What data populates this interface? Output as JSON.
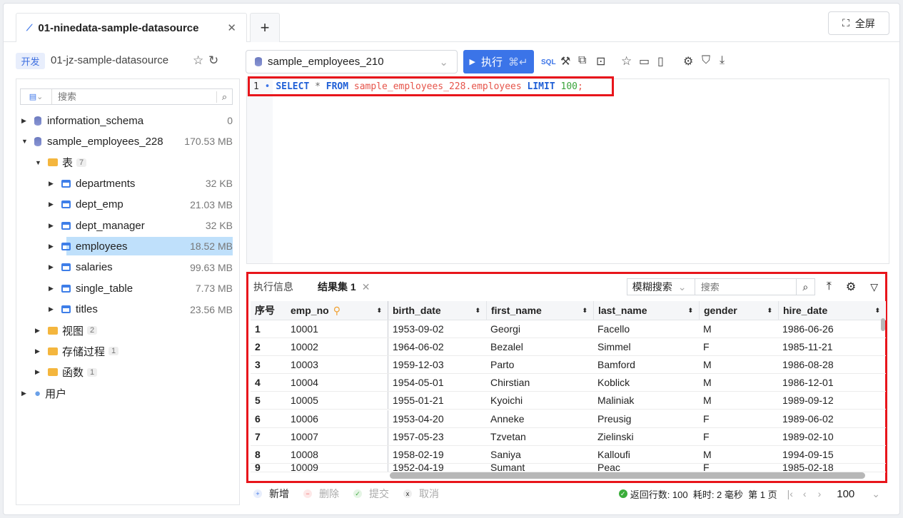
{
  "tabs": {
    "active_label": "01-ninedata-sample-datasource",
    "add": "+",
    "fullscreen": "全屏"
  },
  "datasource": {
    "env_badge": "开发",
    "name": "01-jz-sample-datasource"
  },
  "tree": {
    "search_placeholder": "搜索",
    "items": [
      {
        "level": 0,
        "type": "db",
        "label": "information_schema",
        "size": "0",
        "expanded": false
      },
      {
        "level": 0,
        "type": "db",
        "label": "sample_employees_228",
        "size": "170.53 MB",
        "expanded": true
      },
      {
        "level": 1,
        "type": "folder",
        "label": "表",
        "count": "7",
        "expanded": true
      },
      {
        "level": 2,
        "type": "table",
        "label": "departments",
        "size": "32 KB"
      },
      {
        "level": 2,
        "type": "table",
        "label": "dept_emp",
        "size": "21.03 MB"
      },
      {
        "level": 2,
        "type": "table",
        "label": "dept_manager",
        "size": "32 KB"
      },
      {
        "level": 2,
        "type": "table",
        "label": "employees",
        "size": "18.52 MB",
        "selected": true
      },
      {
        "level": 2,
        "type": "table",
        "label": "salaries",
        "size": "99.63 MB"
      },
      {
        "level": 2,
        "type": "table",
        "label": "single_table",
        "size": "7.73 MB"
      },
      {
        "level": 2,
        "type": "table",
        "label": "titles",
        "size": "23.56 MB"
      },
      {
        "level": 1,
        "type": "folder",
        "label": "视图",
        "count": "2"
      },
      {
        "level": 1,
        "type": "folder",
        "label": "存储过程",
        "count": "1"
      },
      {
        "level": 1,
        "type": "folder",
        "label": "函数",
        "count": "1"
      },
      {
        "level": 0,
        "type": "user",
        "label": "用户"
      }
    ]
  },
  "toolbar": {
    "database": "sample_employees_210",
    "run": "执行",
    "run_shortcut": "⌘↵"
  },
  "editor": {
    "line": "1",
    "sql": [
      {
        "t": "SELECT",
        "c": "#1f5fd6",
        "b": true
      },
      {
        "t": " * ",
        "c": "#666"
      },
      {
        "t": "FROM",
        "c": "#1f5fd6",
        "b": true
      },
      {
        "t": " sample_employees_228.employees ",
        "c": "#e6544a"
      },
      {
        "t": "LIMIT",
        "c": "#1f5fd6",
        "b": true
      },
      {
        "t": " 100",
        "c": "#3aa43a"
      },
      {
        "t": ";",
        "c": "#e6544a"
      }
    ]
  },
  "results": {
    "tab_info": "执行信息",
    "tab_result": "结果集 1",
    "search_mode": "模糊搜索",
    "search_placeholder": "搜索",
    "columns": [
      "序号",
      "emp_no",
      "birth_date",
      "first_name",
      "last_name",
      "gender",
      "hire_date"
    ],
    "rows": [
      [
        "1",
        "10001",
        "1953-09-02",
        "Georgi",
        "Facello",
        "M",
        "1986-06-26"
      ],
      [
        "2",
        "10002",
        "1964-06-02",
        "Bezalel",
        "Simmel",
        "F",
        "1985-11-21"
      ],
      [
        "3",
        "10003",
        "1959-12-03",
        "Parto",
        "Bamford",
        "M",
        "1986-08-28"
      ],
      [
        "4",
        "10004",
        "1954-05-01",
        "Chirstian",
        "Koblick",
        "M",
        "1986-12-01"
      ],
      [
        "5",
        "10005",
        "1955-01-21",
        "Kyoichi",
        "Maliniak",
        "M",
        "1989-09-12"
      ],
      [
        "6",
        "10006",
        "1953-04-20",
        "Anneke",
        "Preusig",
        "F",
        "1989-06-02"
      ],
      [
        "7",
        "10007",
        "1957-05-23",
        "Tzvetan",
        "Zielinski",
        "F",
        "1989-02-10"
      ],
      [
        "8",
        "10008",
        "1958-02-19",
        "Saniya",
        "Kalloufi",
        "M",
        "1994-09-15"
      ],
      [
        "9",
        "10009",
        "1952-04-19",
        "Sumant",
        "Peac",
        "F",
        "1985-02-18"
      ]
    ]
  },
  "footer": {
    "add": "新增",
    "delete": "删除",
    "commit": "提交",
    "cancel": "取消",
    "status": "返回行数: 100  耗时: 2 毫秒  第 1 页",
    "page_size": "100"
  }
}
